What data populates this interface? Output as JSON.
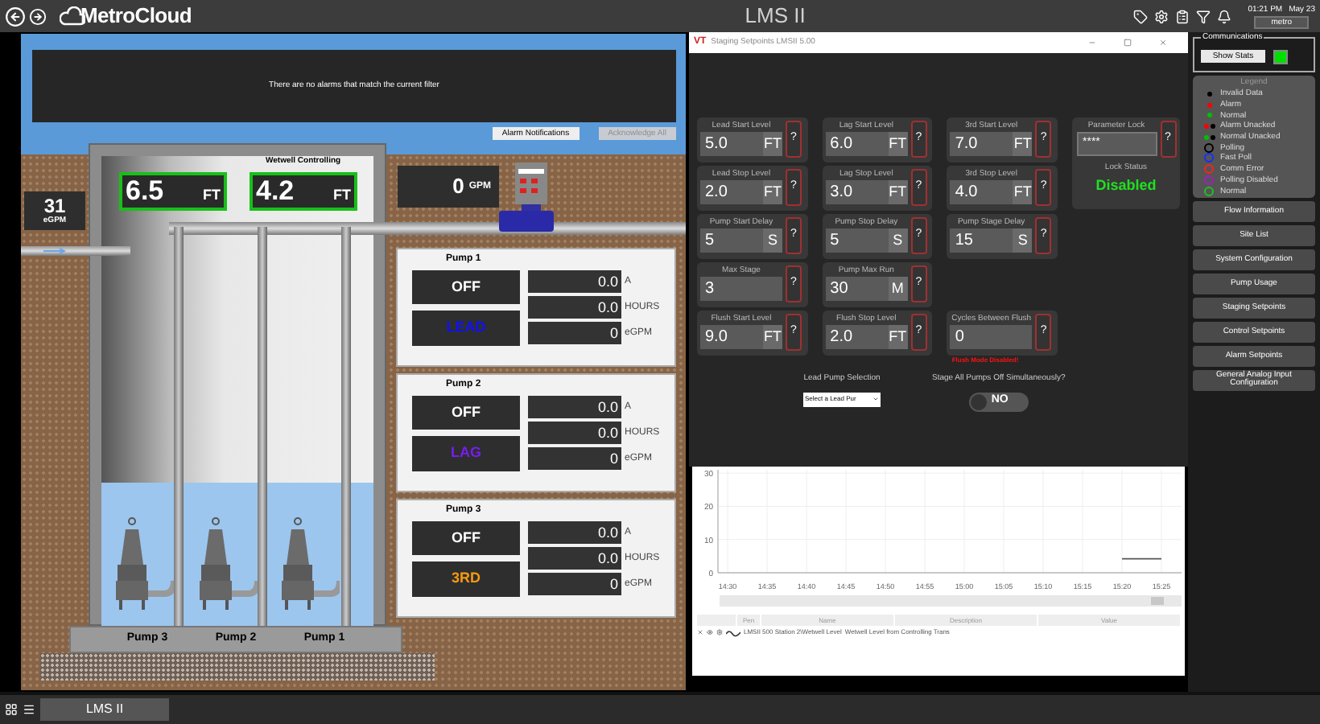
{
  "top_bar": {
    "logo": "MetroCloud",
    "title": "LMS II",
    "time": "01:21 PM",
    "date": "May 23",
    "user": "metro"
  },
  "alarms": {
    "message": "There are no alarms that match the current filter",
    "buttons": [
      {
        "label": "Alarm Notifications",
        "disabled": false
      },
      {
        "label": "Acknowledge All",
        "disabled": true
      }
    ]
  },
  "wetwell": {
    "title": "Wetwell Controlling",
    "levels": [
      {
        "value": "6.5",
        "unit": "FT"
      },
      {
        "value": "4.2",
        "unit": "FT"
      }
    ],
    "inflow": {
      "value": "31",
      "unit": "eGPM"
    },
    "outflow": {
      "value": "0",
      "unit": "GPM"
    },
    "pump_labels": [
      "Pump 3",
      "Pump 2",
      "Pump 1"
    ]
  },
  "pumps": [
    {
      "name": "Pump 1",
      "state": "OFF",
      "role": "LEAD",
      "color": "#1010ff",
      "readings": [
        {
          "value": "0.0",
          "unit": "A"
        },
        {
          "value": "0.0",
          "unit": "HOURS"
        },
        {
          "value": "0",
          "unit": "eGPM"
        }
      ]
    },
    {
      "name": "Pump 2",
      "state": "OFF",
      "role": "LAG",
      "color": "#7a1cf0",
      "readings": [
        {
          "value": "0.0",
          "unit": "A"
        },
        {
          "value": "0.0",
          "unit": "HOURS"
        },
        {
          "value": "0",
          "unit": "eGPM"
        }
      ]
    },
    {
      "name": "Pump 3",
      "state": "OFF",
      "role": "3RD",
      "color": "#f59a10",
      "readings": [
        {
          "value": "0.0",
          "unit": "A"
        },
        {
          "value": "0.0",
          "unit": "HOURS"
        },
        {
          "value": "0",
          "unit": "eGPM"
        }
      ]
    }
  ],
  "dialog": {
    "logo": "VT",
    "title": "Staging Setpoints LMSII 5.00",
    "setpoint_rows": [
      [
        {
          "label": "Lead Start Level",
          "value": "5.0",
          "unit": "FT",
          "help": "?"
        },
        {
          "label": "Lag Start Level",
          "value": "6.0",
          "unit": "FT",
          "help": "?"
        },
        {
          "label": "3rd Start Level",
          "value": "7.0",
          "unit": "FT",
          "help": "?"
        }
      ],
      [
        {
          "label": "Lead Stop Level",
          "value": "2.0",
          "unit": "FT",
          "help": "?"
        },
        {
          "label": "Lag Stop Level",
          "value": "3.0",
          "unit": "FT",
          "help": "?"
        },
        {
          "label": "3rd Stop Level",
          "value": "4.0",
          "unit": "FT",
          "help": "?"
        }
      ],
      [
        {
          "label": "Pump Start Delay",
          "value": "5",
          "unit": "S",
          "help": "?"
        },
        {
          "label": "Pump Stop Delay",
          "value": "5",
          "unit": "S",
          "help": "?"
        },
        {
          "label": "Pump Stage Delay",
          "value": "15",
          "unit": "S",
          "help": "?"
        }
      ],
      [
        {
          "label": "Max Stage",
          "value": "3",
          "help": "?"
        },
        {
          "label": "Pump Max Run",
          "value": "30",
          "unit": "M",
          "help": "?"
        }
      ],
      [
        {
          "label": "Flush Start Level",
          "value": "9.0",
          "unit": "FT",
          "help": "?"
        },
        {
          "label": "Flush Stop Level",
          "value": "2.0",
          "unit": "FT",
          "help": "?"
        },
        {
          "label": "Cycles Between Flush",
          "value": "0",
          "help": "?",
          "note": "Flush Mode Disabled!"
        }
      ]
    ],
    "parameter_lock": {
      "label": "Parameter Lock",
      "value": "****",
      "help": "?"
    },
    "lock_status": {
      "label": "Lock Status",
      "value": "Disabled"
    },
    "lead_pump_selection": {
      "label": "Lead Pump Selection",
      "value": "Select a Lead Pur"
    },
    "stage_all_off": {
      "label": "Stage All Pumps Off Simultaneously?",
      "on": false,
      "value": "NO"
    }
  },
  "trend": {
    "chart_data": {
      "type": "line",
      "x": [
        "14:30",
        "14:35",
        "14:40",
        "14:45",
        "14:50",
        "14:55",
        "15:00",
        "15:05",
        "15:10",
        "15:15",
        "15:20",
        "15:25"
      ],
      "yticks": [
        0,
        10,
        20,
        30
      ],
      "ylim": [
        0,
        31
      ],
      "grid": true,
      "series": [
        {
          "color": "#555555",
          "values": [
            null,
            null,
            null,
            null,
            null,
            null,
            null,
            null,
            null,
            null,
            4.2,
            4.2
          ]
        }
      ]
    },
    "table": {
      "columns": [
        "Pen",
        "Name",
        "Description",
        "Value"
      ],
      "rows": [
        {
          "name": "LMSII 500 Station 2\\Wetwell Level",
          "description": "Wetwell Level from Controlling Trans"
        }
      ]
    }
  },
  "right_panel": {
    "communications": {
      "title": "Communications",
      "button": "Show Stats",
      "color": "#00e000"
    },
    "legend": {
      "title": "Legend",
      "items": [
        {
          "label": "Invalid Data",
          "kind": "dot",
          "color": "#000000"
        },
        {
          "label": "Alarm",
          "kind": "dot",
          "color": "#ff0000"
        },
        {
          "label": "Normal",
          "kind": "dot",
          "color": "#00c000"
        },
        {
          "label": "Alarm Unacked",
          "kind": "pair",
          "color": "#ff0000"
        },
        {
          "label": "Normal Unacked",
          "kind": "pair",
          "color": "#00c000"
        },
        {
          "label": "Polling",
          "kind": "ring",
          "color": "#000000"
        },
        {
          "label": "Fast Poll",
          "kind": "ring",
          "color": "#1030ff"
        },
        {
          "label": "Comm Error",
          "kind": "ring",
          "color": "#ff2020"
        },
        {
          "label": "Polling Disabled",
          "kind": "ring",
          "color": "#a020c0"
        },
        {
          "label": "Normal",
          "kind": "ring",
          "color": "#20c020"
        }
      ]
    },
    "nav": [
      "Flow Information",
      "Site List",
      "System Configuration",
      "Pump Usage",
      "Staging Setpoints",
      "Control Setpoints",
      "Alarm Setpoints",
      "General Analog Input Configuration"
    ]
  },
  "taskbar": {
    "tabs": [
      {
        "label": "LMS II",
        "selected": true
      }
    ]
  }
}
